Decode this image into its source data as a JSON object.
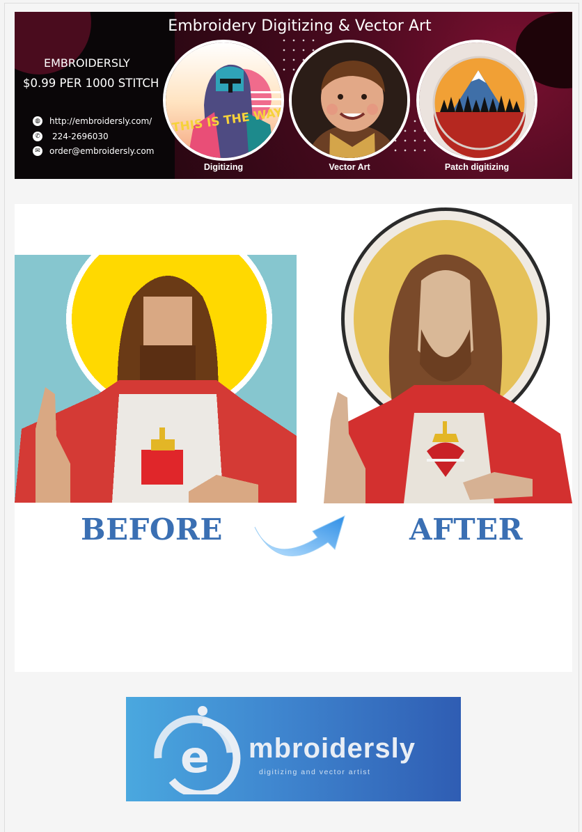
{
  "banner": {
    "title": "Embroidery Digitizing & Vector Art",
    "brand": "EMBROIDERSLY",
    "price": "$0.99 PER 1000 STITCH",
    "contacts": [
      {
        "icon": "globe-icon",
        "text": "http://embroidersly.com/"
      },
      {
        "icon": "phone-icon",
        "text": "224-2696030"
      },
      {
        "icon": "mail-icon",
        "text": "order@embroidersly.com"
      }
    ],
    "services": [
      {
        "label": "Digitizing",
        "image_text": "THIS IS THE WAY"
      },
      {
        "label": "Vector Art"
      },
      {
        "label": "Patch digitizing"
      }
    ]
  },
  "comparison": {
    "before_label": "BEFORE",
    "after_label": "AFTER"
  },
  "logo": {
    "letter": "e",
    "word": "mbroidersly",
    "tagline": "digitizing and vector artist"
  },
  "colors": {
    "banner_accent": "#6b0f2b",
    "label_blue": "#3a6fb3",
    "logo_gradient_start": "#4aa8df",
    "logo_gradient_end": "#2f5db3",
    "arrow_blue": "#3d9be9"
  }
}
